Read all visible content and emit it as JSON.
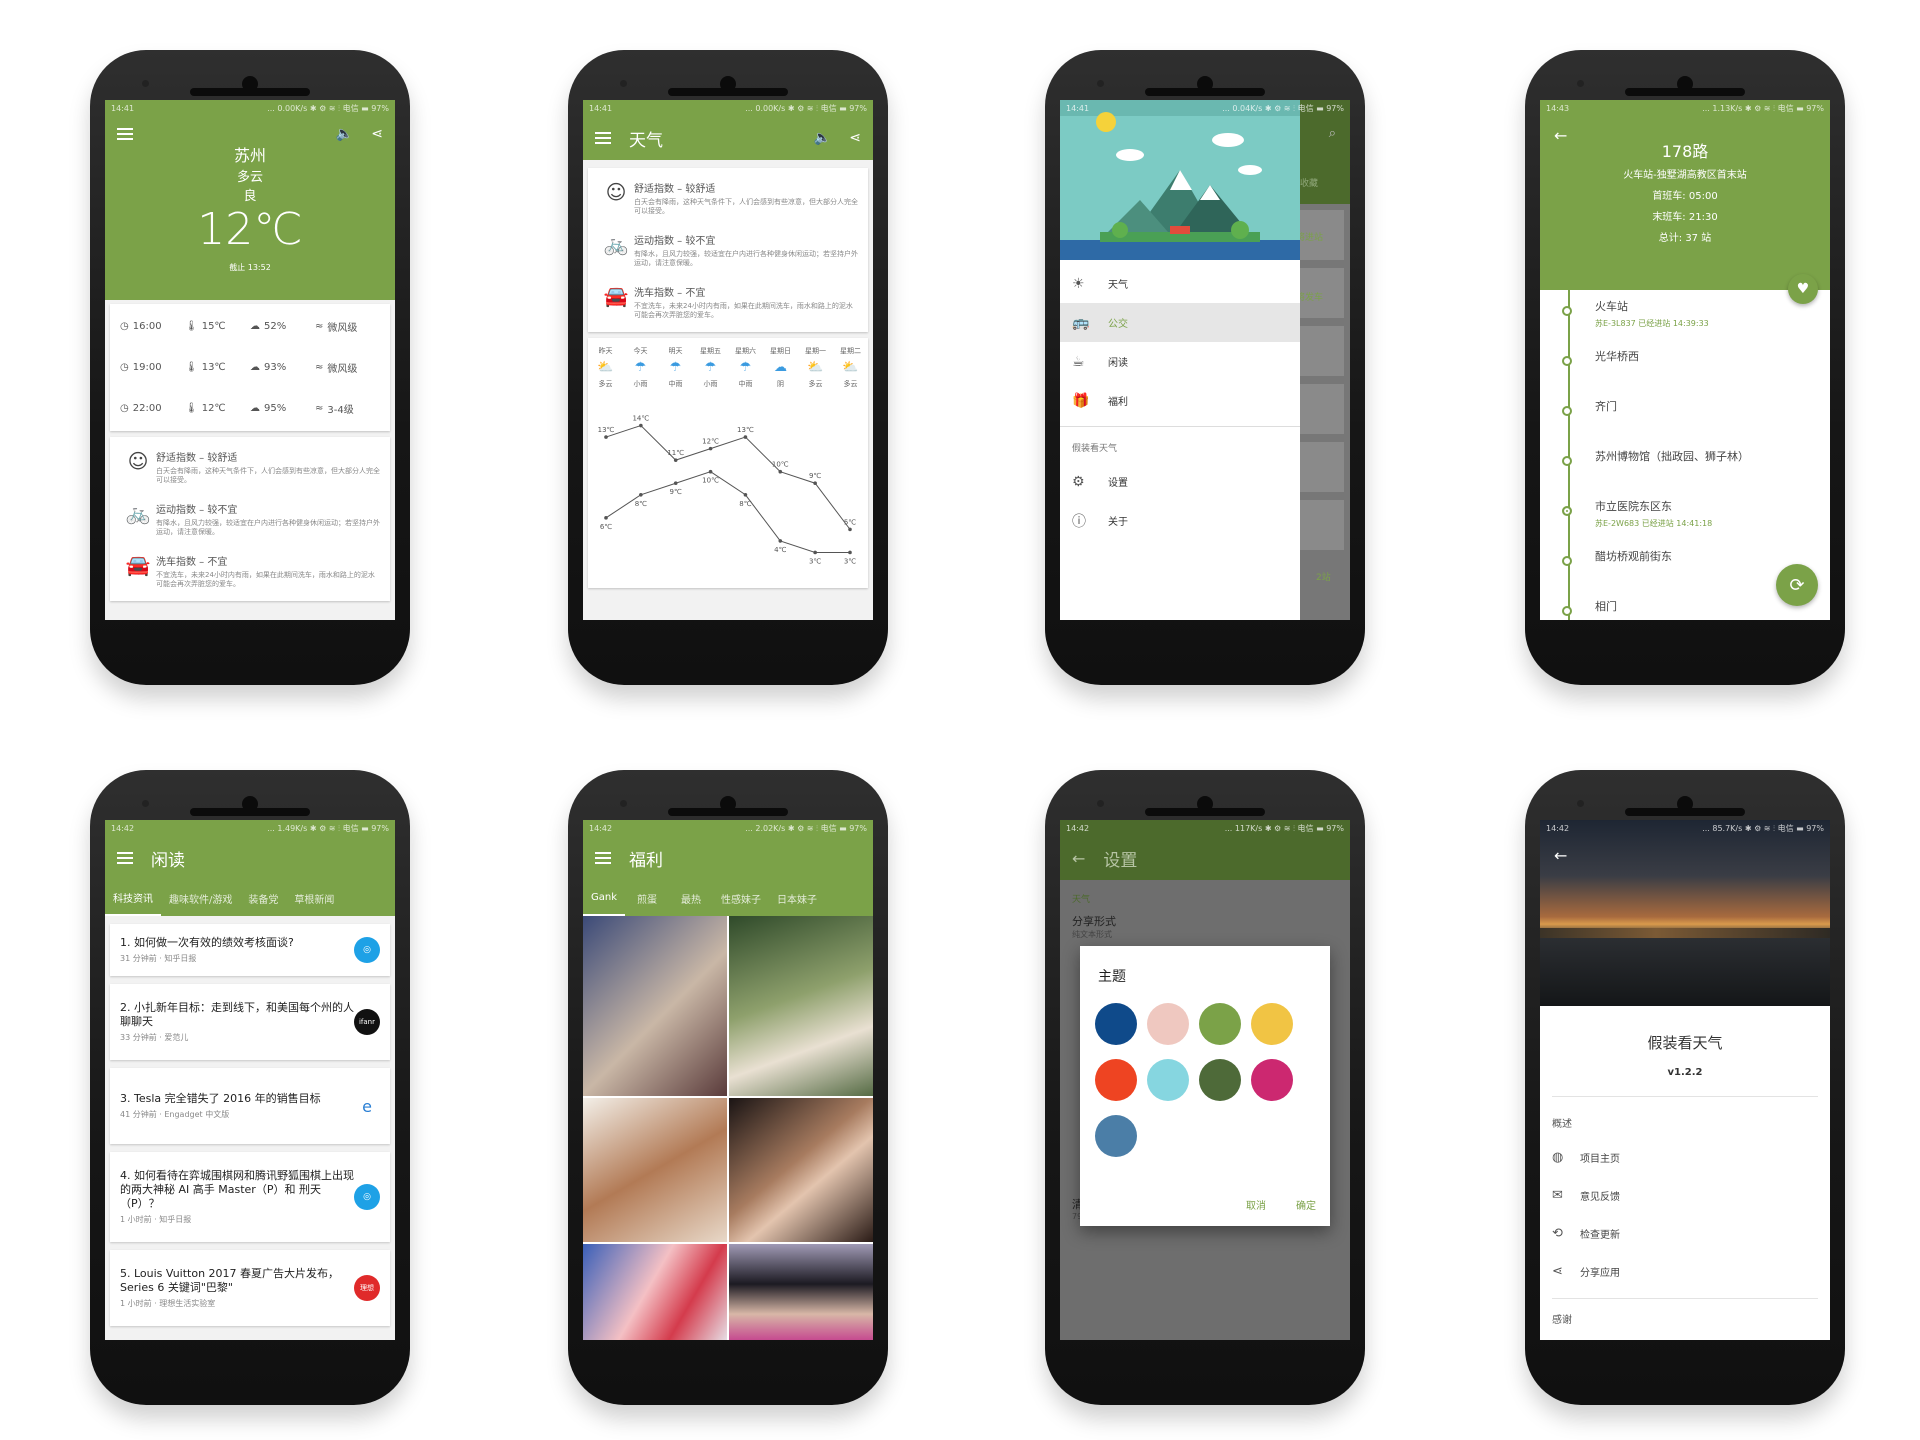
{
  "p1": {
    "status_time": "14:41",
    "status_right": "... 0.00K/s ✱ ⚙ ≋ ⫶ 电信 ▬ 97%",
    "city": "苏州",
    "weather": "多云",
    "aqi": "良",
    "temp": "12℃",
    "updated": "截止 13:52",
    "hourly": [
      {
        "time": "16:00",
        "temp": "15℃",
        "hum": "52%",
        "wind": "微风级"
      },
      {
        "time": "19:00",
        "temp": "13℃",
        "hum": "93%",
        "wind": "微风级"
      },
      {
        "time": "22:00",
        "temp": "12℃",
        "hum": "95%",
        "wind": "3-4级"
      }
    ]
  },
  "sugs": [
    {
      "title": "舒适指数 – 较舒适",
      "desc": "白天会有降雨，这种天气条件下，人们会感到有些凉意，但大部分人完全可以接受。"
    },
    {
      "title": "运动指数 – 较不宜",
      "desc": "有降水，且风力较强，较适宜在户内进行各种健身休闲运动；若坚持户外运动，请注意保暖。"
    },
    {
      "title": "洗车指数 – 不宜",
      "desc": "不宜洗车，未来24小时内有雨，如果在此期间洗车，雨水和路上的泥水可能会再次弄脏您的爱车。"
    }
  ],
  "p2": {
    "status_time": "14:41",
    "status_right": "... 0.00K/s ✱ ⚙ ≋ ⫶ 电信 ▬ 97%",
    "title": "天气",
    "days": [
      "昨天",
      "今天",
      "明天",
      "星期五",
      "星期六",
      "星期日",
      "星期一",
      "星期二"
    ],
    "conds": [
      "多云",
      "小雨",
      "中雨",
      "小雨",
      "中雨",
      "阴",
      "多云",
      "多云"
    ],
    "high_labels": [
      "13℃",
      "14℃",
      "11℃",
      "12℃",
      "13℃",
      "10℃",
      "9℃",
      "5℃"
    ],
    "low_labels": [
      "6℃",
      "8℃",
      "9℃",
      "10℃",
      "8℃",
      "4℃",
      "3℃",
      "3℃"
    ]
  },
  "chart_data": {
    "type": "line",
    "categories": [
      "昨天",
      "今天",
      "明天",
      "星期五",
      "星期六",
      "星期日",
      "星期一",
      "星期二"
    ],
    "series": [
      {
        "values": [
          13,
          14,
          11,
          12,
          13,
          10,
          9,
          5
        ]
      },
      {
        "values": [
          6,
          8,
          9,
          10,
          8,
          4,
          3,
          3
        ]
      }
    ],
    "ylim": [
      2,
      15
    ]
  },
  "p3": {
    "status_time": "14:41",
    "status_right": "... 0.04K/s ✱ ⚙ ≋ ⫶ 电信 ▬ 97%",
    "menu": [
      "天气",
      "公交",
      "闲读",
      "福利"
    ],
    "section": "假装看天气",
    "menu2": [
      "设置",
      "关于"
    ],
    "behind": [
      "收藏",
      "将进站",
      "将发车",
      "2站"
    ]
  },
  "p4": {
    "status_time": "14:43",
    "status_right": "... 1.13K/s ✱ ⚙ ≋ ⫶ 电信 ▬ 97%",
    "route": "178路",
    "direction": "火车站-独墅湖高教区首末站",
    "first": "首班车: 05:00",
    "last": "末班车: 21:30",
    "total": "总计: 37 站",
    "stops": [
      {
        "name": "火车站",
        "sub": "苏E-3L837  已经进站 14:39:33"
      },
      {
        "name": "光华桥西",
        "sub": ""
      },
      {
        "name": "齐门",
        "sub": ""
      },
      {
        "name": "苏州博物馆（拙政园、狮子林）",
        "sub": ""
      },
      {
        "name": "市立医院东区东",
        "sub": "苏E-2W683  已经进站 14:41:18"
      },
      {
        "name": "醋坊桥观前街东",
        "sub": ""
      },
      {
        "name": "相门",
        "sub": ""
      }
    ]
  },
  "p5": {
    "status_time": "14:42",
    "status_right": "... 1.49K/s ✱ ⚙ ≋ ⫶ 电信 ▬ 97%",
    "title": "闲读",
    "tabs": [
      "科技资讯",
      "趣味软件/游戏",
      "装备党",
      "草根新闻"
    ],
    "news": [
      {
        "title": "1. 如何做一次有效的绩效考核面谈?",
        "meta": "31 分钟前 · 知乎日报",
        "logo": "◎",
        "color": "#1ea1e6"
      },
      {
        "title": "2. 小扎新年目标：走到线下，和美国每个州的人聊聊天",
        "meta": "33 分钟前 · 爱范儿",
        "logo": "ifanr",
        "color": "#111111"
      },
      {
        "title": "3. Tesla 完全错失了 2016 年的销售目标",
        "meta": "41 分钟前 · Engadget 中文版",
        "logo": "e",
        "color": "#2a7fd4"
      },
      {
        "title": "4. 如何看待在弈城围棋网和腾讯野狐围棋上出现的两大神秘 AI 高手 Master（P）和 刑天（P）？",
        "meta": "1 小时前 · 知乎日报",
        "logo": "◎",
        "color": "#1ea1e6"
      },
      {
        "title": "5. Louis Vuitton 2017 春夏广告大片发布，Series 6 关键词\"巴黎\"",
        "meta": "1 小时前 · 理想生活实验室",
        "logo": "理想",
        "color": "#e02a2a"
      }
    ]
  },
  "p6": {
    "status_time": "14:42",
    "status_right": "... 2.02K/s ✱ ⚙ ≋ ⫶ 电信 ▬ 97%",
    "title": "福利",
    "tabs": [
      "Gank",
      "煎蛋",
      "最热",
      "性感妹子",
      "日本妹子"
    ]
  },
  "p7": {
    "status_time": "14:42",
    "status_right": "... 117K/s ✱ ⚙ ≋ ⫶ 电信 ▬ 97%",
    "title": "设置",
    "section": "天气",
    "share_label": "分享形式",
    "share_value": "纯文本形式",
    "cache_label": "清除缓存",
    "cache_value": "79.40 MB",
    "dialog_title": "主题",
    "cancel": "取消",
    "ok": "确定",
    "swatches": [
      "#0f4a8a",
      "#efc8c0",
      "#7ba248",
      "#f1c444",
      "#ee4422",
      "#86d6e0",
      "#4e6a39",
      "#cc2870",
      "#4b7ea7"
    ]
  },
  "p8": {
    "status_time": "14:42",
    "status_right": "... 85.7K/s ✱ ⚙ ≋ ⫶ 电信 ▬ 97%",
    "app_name": "假装看天气",
    "version": "v1.2.2",
    "section": "概述",
    "rows": [
      "项目主页",
      "意见反馈",
      "检查更新",
      "分享应用"
    ],
    "next_section": "感谢"
  }
}
